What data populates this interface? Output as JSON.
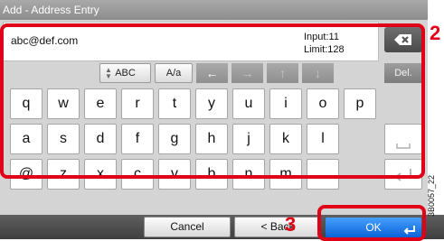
{
  "title": "Add - Address Entry",
  "entry": {
    "value": "abc@def.com",
    "input_label": "Input:",
    "input_value": "11",
    "limit_label": "Limit:",
    "limit_value": "128"
  },
  "modebar": {
    "case_label": "ABC",
    "toggle_label": "A/a",
    "delete_label": "Del."
  },
  "keys": {
    "row1": [
      "q",
      "w",
      "e",
      "r",
      "t",
      "y",
      "u",
      "i",
      "o",
      "p"
    ],
    "row2": [
      "a",
      "s",
      "d",
      "f",
      "g",
      "h",
      "j",
      "k",
      "l"
    ],
    "row3": [
      "@",
      "z",
      "x",
      "c",
      "v",
      "b",
      "n",
      "m",
      "."
    ]
  },
  "footer": {
    "cancel": "Cancel",
    "back": "< Back",
    "ok": "OK"
  },
  "callouts": {
    "step2": "2",
    "step3": "3"
  },
  "figure_code": "3B0057_22",
  "colors": {
    "highlight": "#e00018",
    "ok_blue": "#1a73e8"
  },
  "icons": [
    "backspace-icon",
    "arrow-left-icon",
    "arrow-right-icon",
    "arrow-up-icon",
    "arrow-down-icon",
    "space-icon",
    "enter-icon"
  ]
}
